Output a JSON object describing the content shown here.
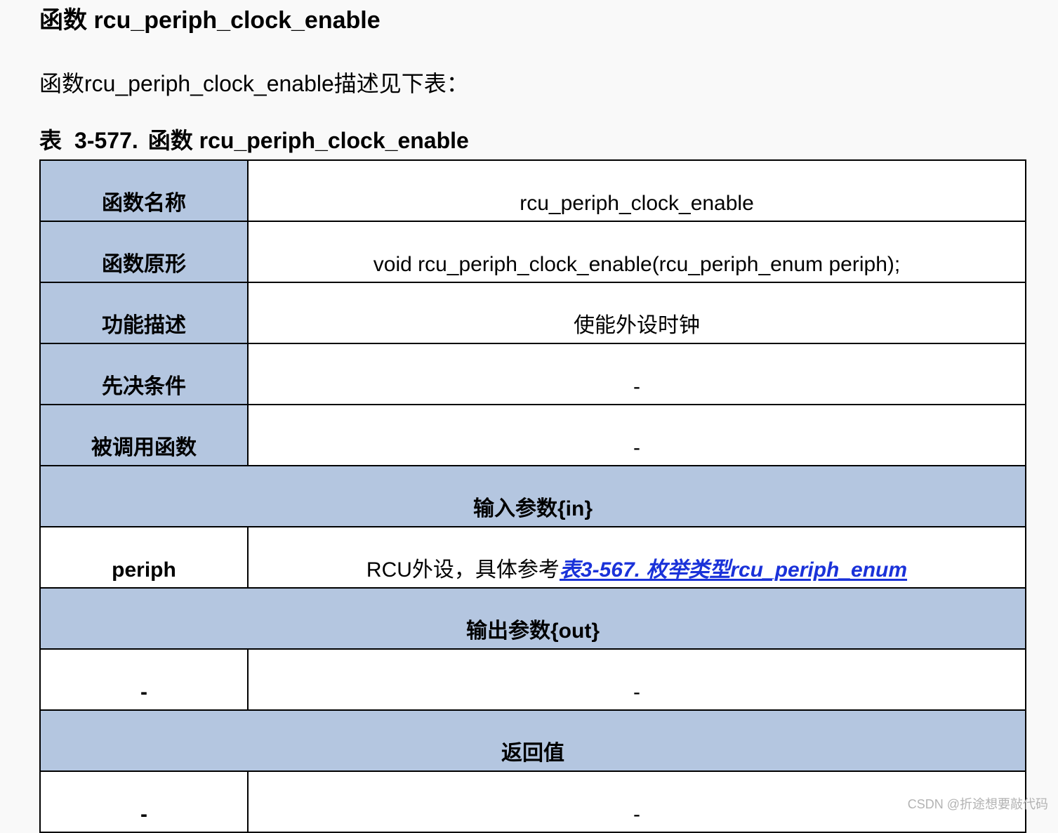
{
  "heading": "函数 rcu_periph_clock_enable",
  "intro": "函数rcu_periph_clock_enable描述见下表：",
  "caption": {
    "prefix": "表",
    "number": "3-577.",
    "title": "函数 rcu_periph_clock_enable"
  },
  "table": {
    "rows": [
      {
        "label": "函数名称",
        "value": "rcu_periph_clock_enable"
      },
      {
        "label": "函数原形",
        "value": "void rcu_periph_clock_enable(rcu_periph_enum periph);"
      },
      {
        "label": "功能描述",
        "value": "使能外设时钟"
      },
      {
        "label": "先决条件",
        "value": "-"
      },
      {
        "label": "被调用函数",
        "value": "-"
      }
    ],
    "input_header": "输入参数{in}",
    "input_param": {
      "name": "periph",
      "desc_prefix": "RCU外设，具体参考",
      "desc_link": "表3-567. 枚举类型rcu_periph_enum"
    },
    "output_header": "输出参数{out}",
    "output_param": {
      "name": "-",
      "desc": "-"
    },
    "return_header": "返回值",
    "return_value": {
      "name": "-",
      "desc": "-"
    }
  },
  "watermark": "CSDN @折途想要敲代码"
}
